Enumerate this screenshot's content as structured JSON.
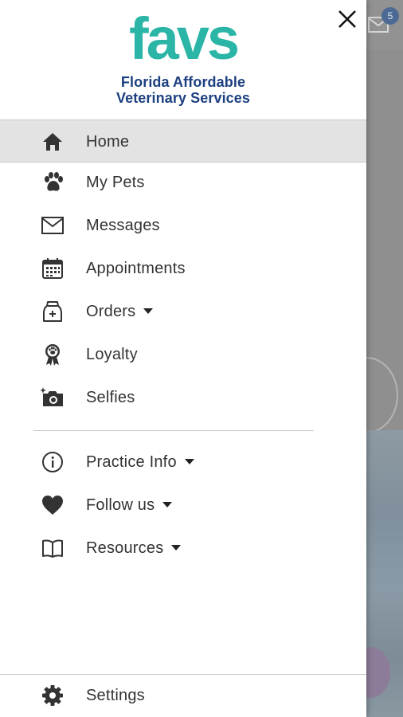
{
  "background": {
    "mail_badge": "5"
  },
  "drawer": {
    "logo": {
      "mark": "favs",
      "line1": "Florida Affordable",
      "line2": "Veterinary Services"
    },
    "items": [
      {
        "label": "Home",
        "icon": "home-icon",
        "dropdown": false,
        "active": true
      },
      {
        "label": "My Pets",
        "icon": "paw-icon",
        "dropdown": false
      },
      {
        "label": "Messages",
        "icon": "envelope-icon",
        "dropdown": false
      },
      {
        "label": "Appointments",
        "icon": "calendar-icon",
        "dropdown": false
      },
      {
        "label": "Orders",
        "icon": "pet-food-bag-icon",
        "dropdown": true
      },
      {
        "label": "Loyalty",
        "icon": "paw-ribbon-icon",
        "dropdown": false
      },
      {
        "label": "Selfies",
        "icon": "camera-icon",
        "dropdown": false
      }
    ],
    "secondary_items": [
      {
        "label": "Practice Info",
        "icon": "info-icon",
        "dropdown": true
      },
      {
        "label": "Follow us",
        "icon": "heart-icon",
        "dropdown": true
      },
      {
        "label": "Resources",
        "icon": "book-icon",
        "dropdown": true
      }
    ],
    "footer": {
      "label": "Settings",
      "icon": "gear-icon"
    }
  },
  "colors": {
    "brand_teal": "#2ab5a7",
    "brand_navy": "#1b3f80",
    "icon": "#333333",
    "active_row": "#e3e3e3"
  }
}
